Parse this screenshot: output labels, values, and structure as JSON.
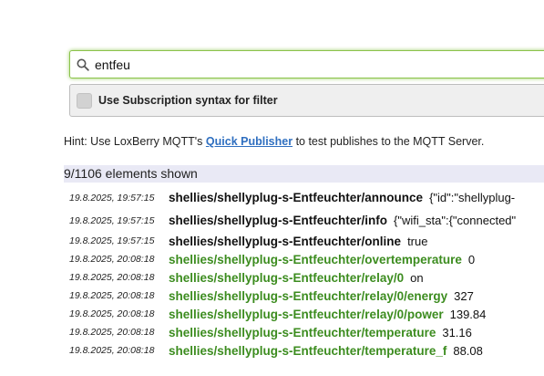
{
  "search": {
    "value": "entfeu"
  },
  "filter": {
    "label": "Use Subscription syntax for filter",
    "checked": false
  },
  "hint": {
    "prefix": "Hint: Use LoxBerry MQTT's",
    "link": "Quick Publisher",
    "suffix": "to test publishes to the MQTT Server."
  },
  "count": {
    "text": "9/1106 elements shown"
  },
  "rows": [
    {
      "ts": "19.8.2025, 19:57:15",
      "topic": "shellies/shellyplug-s-Entfeuchter/announce",
      "value": "{\"id\":\"shellyplug-",
      "highlight": false
    },
    {
      "ts": "19.8.2025, 19:57:15",
      "topic": "shellies/shellyplug-s-Entfeuchter/info",
      "value": "{\"wifi_sta\":{\"connected\"",
      "highlight": false
    },
    {
      "ts": "19.8.2025, 19:57:15",
      "topic": "shellies/shellyplug-s-Entfeuchter/online",
      "value": "true",
      "highlight": false
    },
    {
      "ts": "19.8.2025, 20:08:18",
      "topic": "shellies/shellyplug-s-Entfeuchter/overtemperature",
      "value": "0",
      "highlight": true
    },
    {
      "ts": "19.8.2025, 20:08:18",
      "topic": "shellies/shellyplug-s-Entfeuchter/relay/0",
      "value": "on",
      "highlight": true
    },
    {
      "ts": "19.8.2025, 20:08:18",
      "topic": "shellies/shellyplug-s-Entfeuchter/relay/0/energy",
      "value": "327",
      "highlight": true
    },
    {
      "ts": "19.8.2025, 20:08:18",
      "topic": "shellies/shellyplug-s-Entfeuchter/relay/0/power",
      "value": "139.84",
      "highlight": true
    },
    {
      "ts": "19.8.2025, 20:08:18",
      "topic": "shellies/shellyplug-s-Entfeuchter/temperature",
      "value": "31.16",
      "highlight": true
    },
    {
      "ts": "19.8.2025, 20:08:18",
      "topic": "shellies/shellyplug-s-Entfeuchter/temperature_f",
      "value": "88.08",
      "highlight": true
    }
  ],
  "colors": {
    "highlight_topic": "#3c8c1f",
    "link": "#2f6fc0",
    "focus_border": "#8bc34a",
    "count_bar_bg": "#e9e9f5"
  }
}
